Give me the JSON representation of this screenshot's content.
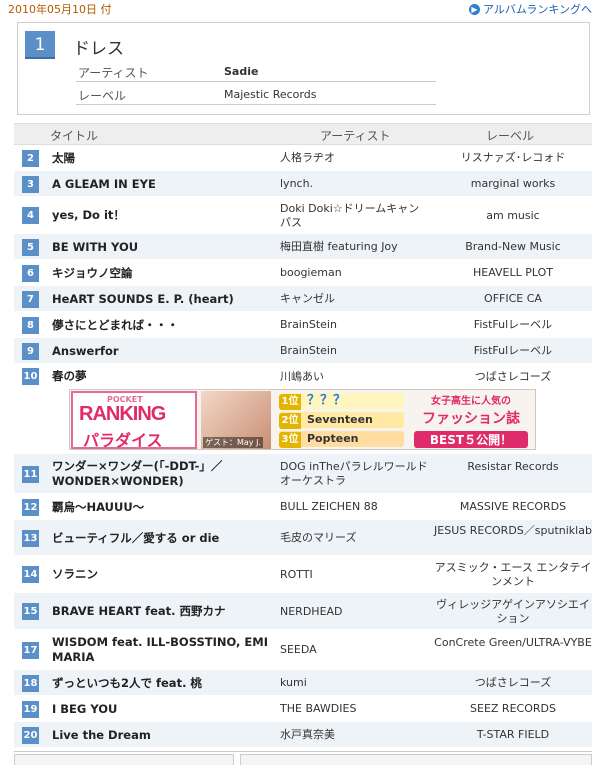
{
  "header": {
    "date": "2010年05月10日 付",
    "album_link": "アルバムランキングへ"
  },
  "top": {
    "rank": "1",
    "title": "ドレス",
    "artist_label": "アーティスト",
    "artist": "Sadie",
    "label_label": "レーベル",
    "label": "Majestic Records"
  },
  "table_headers": {
    "title": "タイトル",
    "artist": "アーティスト",
    "label": "レーベル"
  },
  "rows": [
    {
      "rank": "2",
      "title": "太陽",
      "artist": "人格ラヂオ",
      "label": "リスナァズ･レコォド"
    },
    {
      "rank": "3",
      "title": "A GLEAM IN EYE",
      "artist": "lynch.",
      "label": "marginal works"
    },
    {
      "rank": "4",
      "title": "yes, Do it！",
      "artist": "Doki Doki☆ドリームキャンパス",
      "label": "am music"
    },
    {
      "rank": "5",
      "title": "BE WITH YOU",
      "artist": "梅田直樹 featuring Joy",
      "label": "Brand-New Music"
    },
    {
      "rank": "6",
      "title": "キジョウノ空論",
      "artist": "boogieman",
      "label": "HEAVELL PLOT"
    },
    {
      "rank": "7",
      "title": "HeART SOUNDS E. P. (heart)",
      "artist": "キャンゼル",
      "label": "OFFICE CA"
    },
    {
      "rank": "8",
      "title": "儚さにとどまれば・・・",
      "artist": "BrainStein",
      "label": "FistFulレーベル"
    },
    {
      "rank": "9",
      "title": "Answerfor",
      "artist": "BrainStein",
      "label": "FistFulレーベル"
    },
    {
      "rank": "10",
      "title": "春の夢",
      "artist": "川嶋あい",
      "label": "つばさレコーズ"
    },
    {
      "rank": "11",
      "title": "ワンダー×ワンダー(「-DDT-」／WONDER×WONDER)",
      "artist": "DOG inTheパラレルワールドオーケストラ",
      "label": "Resistar Records"
    },
    {
      "rank": "12",
      "title": "覇烏〜HAUUU〜",
      "artist": "BULL ZEICHEN 88",
      "label": "MASSIVE RECORDS"
    },
    {
      "rank": "13",
      "title": "ビューティフル／愛する or die",
      "artist": "毛皮のマリーズ",
      "label": "JESUS RECORDS／sputniklab"
    },
    {
      "rank": "14",
      "title": "ソラニン",
      "artist": "ROTTI",
      "label": "アスミック・エース エンタテインメント"
    },
    {
      "rank": "15",
      "title": "BRAVE HEART feat. 西野カナ",
      "artist": "NERDHEAD",
      "label": "ヴィレッジアゲインアソシエイション"
    },
    {
      "rank": "17",
      "title": "WISDOM feat. ILL-BOSSTINO, EMI MARIA",
      "artist": "SEEDA",
      "label": "ConCrete Green/ULTRA-VYBE"
    },
    {
      "rank": "18",
      "title": "ずっといつも2人で feat. 桃",
      "artist": "kumi",
      "label": "つばさレコーズ"
    },
    {
      "rank": "19",
      "title": "I BEG YOU",
      "artist": "THE BAWDIES",
      "label": "SEEZ RECORDS"
    },
    {
      "rank": "20",
      "title": "Live the Dream",
      "artist": "水戸真奈美",
      "label": "T-STAR FIELD"
    }
  ],
  "banner": {
    "pocket": "POCKET",
    "ranking": "RANKING",
    "paradise": "パラダイス",
    "guest": "ゲスト：May J.",
    "rank1_pos": "1位",
    "rank1_name": "？？？",
    "rank2_pos": "2位",
    "rank2_name": "Seventeen",
    "rank3_pos": "3位",
    "rank3_name": "Popteen",
    "headline1": "女子高生に人気の",
    "headline2": "ファッション誌",
    "headline3": "BEST５公開！"
  }
}
